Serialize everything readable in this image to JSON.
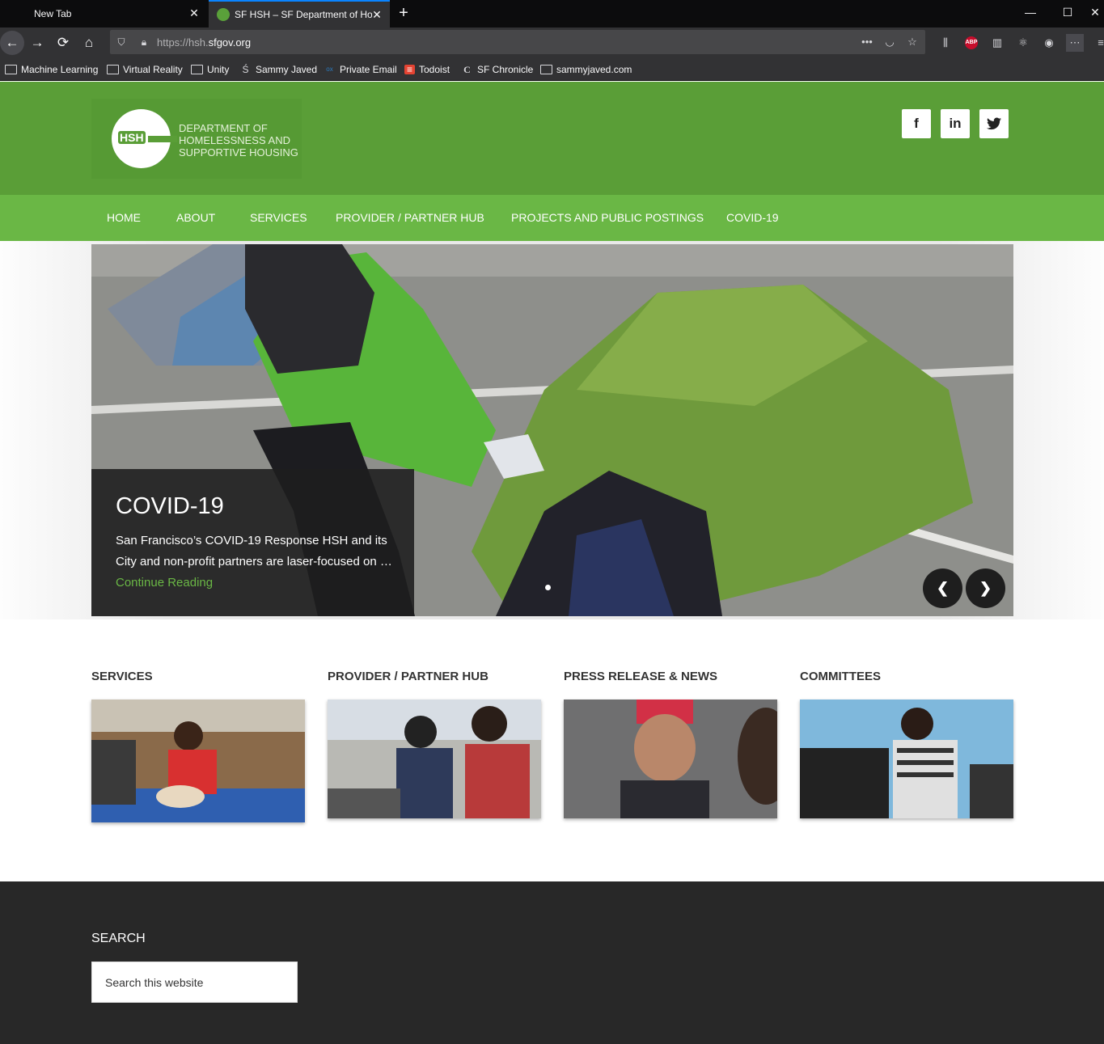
{
  "browser": {
    "tabs": [
      {
        "title": "New Tab",
        "close": "✕"
      },
      {
        "title": "SF HSH – SF Department of Ho",
        "close": "✕"
      }
    ],
    "new_tab": "+",
    "window_controls": {
      "minimize": "—",
      "maximize": "☐",
      "close": "✕"
    },
    "url_prefix": "https://hsh.",
    "url_domain": "sfgov.org",
    "url_more": "•••",
    "bookmarks": [
      {
        "label": "Machine Learning",
        "icon": "folder-icon"
      },
      {
        "label": "Virtual Reality",
        "icon": "folder-icon"
      },
      {
        "label": "Unity",
        "icon": "folder-icon"
      },
      {
        "label": "Sammy Javed",
        "icon": "sj-icon"
      },
      {
        "label": "Private Email",
        "icon": "ox-icon"
      },
      {
        "label": "Todoist",
        "icon": "todoist-icon"
      },
      {
        "label": "SF Chronicle",
        "icon": "chronicle-icon"
      },
      {
        "label": "sammyjaved.com",
        "icon": "folder-icon"
      }
    ],
    "abp_label": "ABP"
  },
  "header": {
    "logo_badge": "HSH",
    "logo_lines": [
      "DEPARTMENT OF",
      "HOMELESSNESS AND",
      "SUPPORTIVE HOUSING"
    ],
    "social": [
      {
        "label": "f",
        "icon": "facebook-icon"
      },
      {
        "label": "in",
        "icon": "linkedin-icon"
      },
      {
        "label": "t",
        "icon": "twitter-icon"
      }
    ],
    "brand_color": "#5a9e37",
    "nav_color": "#6ab745"
  },
  "nav": {
    "items": [
      "HOME",
      "ABOUT",
      "SERVICES",
      "PROVIDER / PARTNER HUB",
      "PROJECTS AND PUBLIC POSTINGS",
      "COVID-19"
    ]
  },
  "slider": {
    "title": "COVID-19",
    "text": "San Francisco’s COVID-19 Response HSH and its City and non-profit partners are laser-focused on …",
    "link": "Continue Reading",
    "prev": "❮",
    "next": "❯"
  },
  "sections": [
    {
      "title": "SERVICES"
    },
    {
      "title": "PROVIDER / PARTNER HUB"
    },
    {
      "title": "PRESS RELEASE & NEWS"
    },
    {
      "title": "COMMITTEES"
    }
  ],
  "footer": {
    "search_title": "SEARCH",
    "search_placeholder": "Search this website"
  }
}
